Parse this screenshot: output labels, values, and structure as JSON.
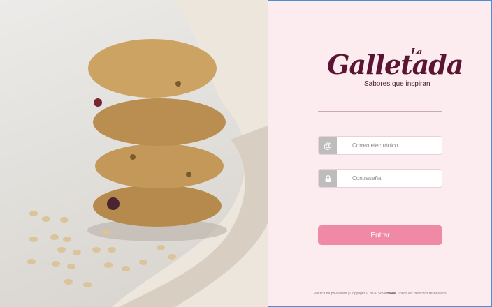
{
  "brand": {
    "logo_prefix": "La",
    "logo_name": "Galletada",
    "tagline": "Sabores que inspiran"
  },
  "form": {
    "email_placeholder": "Correo electrónico",
    "email_icon": "@",
    "password_placeholder": "Contraseña",
    "password_icon_name": "lock-icon",
    "submit_label": "Entrar"
  },
  "footer": {
    "text_before": "Política de privacidad | Copyright © 2020 Smart",
    "text_bold": "Node",
    "text_after": ". Todos los derechos reservados."
  },
  "colors": {
    "panel_background": "#fcecef",
    "brand": "#5b1533",
    "button": "#f08aa4",
    "addon": "#bdbdbd"
  }
}
